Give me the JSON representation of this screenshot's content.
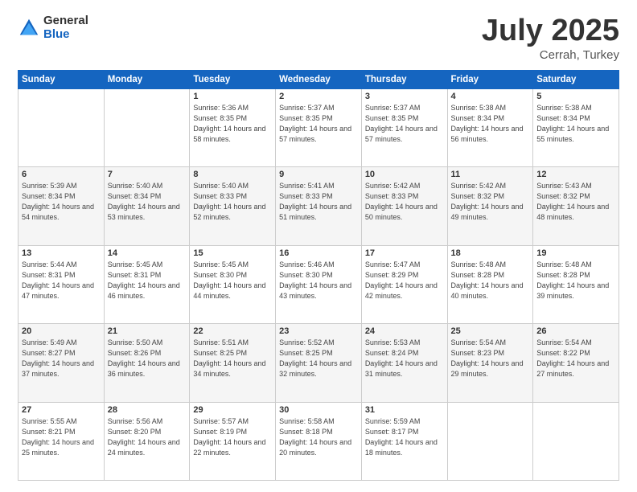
{
  "header": {
    "logo_general": "General",
    "logo_blue": "Blue",
    "title": "July 2025",
    "location": "Cerrah, Turkey"
  },
  "weekdays": [
    "Sunday",
    "Monday",
    "Tuesday",
    "Wednesday",
    "Thursday",
    "Friday",
    "Saturday"
  ],
  "weeks": [
    [
      {
        "day": "",
        "sunrise": "",
        "sunset": "",
        "daylight": ""
      },
      {
        "day": "",
        "sunrise": "",
        "sunset": "",
        "daylight": ""
      },
      {
        "day": "1",
        "sunrise": "Sunrise: 5:36 AM",
        "sunset": "Sunset: 8:35 PM",
        "daylight": "Daylight: 14 hours and 58 minutes."
      },
      {
        "day": "2",
        "sunrise": "Sunrise: 5:37 AM",
        "sunset": "Sunset: 8:35 PM",
        "daylight": "Daylight: 14 hours and 57 minutes."
      },
      {
        "day": "3",
        "sunrise": "Sunrise: 5:37 AM",
        "sunset": "Sunset: 8:35 PM",
        "daylight": "Daylight: 14 hours and 57 minutes."
      },
      {
        "day": "4",
        "sunrise": "Sunrise: 5:38 AM",
        "sunset": "Sunset: 8:34 PM",
        "daylight": "Daylight: 14 hours and 56 minutes."
      },
      {
        "day": "5",
        "sunrise": "Sunrise: 5:38 AM",
        "sunset": "Sunset: 8:34 PM",
        "daylight": "Daylight: 14 hours and 55 minutes."
      }
    ],
    [
      {
        "day": "6",
        "sunrise": "Sunrise: 5:39 AM",
        "sunset": "Sunset: 8:34 PM",
        "daylight": "Daylight: 14 hours and 54 minutes."
      },
      {
        "day": "7",
        "sunrise": "Sunrise: 5:40 AM",
        "sunset": "Sunset: 8:34 PM",
        "daylight": "Daylight: 14 hours and 53 minutes."
      },
      {
        "day": "8",
        "sunrise": "Sunrise: 5:40 AM",
        "sunset": "Sunset: 8:33 PM",
        "daylight": "Daylight: 14 hours and 52 minutes."
      },
      {
        "day": "9",
        "sunrise": "Sunrise: 5:41 AM",
        "sunset": "Sunset: 8:33 PM",
        "daylight": "Daylight: 14 hours and 51 minutes."
      },
      {
        "day": "10",
        "sunrise": "Sunrise: 5:42 AM",
        "sunset": "Sunset: 8:33 PM",
        "daylight": "Daylight: 14 hours and 50 minutes."
      },
      {
        "day": "11",
        "sunrise": "Sunrise: 5:42 AM",
        "sunset": "Sunset: 8:32 PM",
        "daylight": "Daylight: 14 hours and 49 minutes."
      },
      {
        "day": "12",
        "sunrise": "Sunrise: 5:43 AM",
        "sunset": "Sunset: 8:32 PM",
        "daylight": "Daylight: 14 hours and 48 minutes."
      }
    ],
    [
      {
        "day": "13",
        "sunrise": "Sunrise: 5:44 AM",
        "sunset": "Sunset: 8:31 PM",
        "daylight": "Daylight: 14 hours and 47 minutes."
      },
      {
        "day": "14",
        "sunrise": "Sunrise: 5:45 AM",
        "sunset": "Sunset: 8:31 PM",
        "daylight": "Daylight: 14 hours and 46 minutes."
      },
      {
        "day": "15",
        "sunrise": "Sunrise: 5:45 AM",
        "sunset": "Sunset: 8:30 PM",
        "daylight": "Daylight: 14 hours and 44 minutes."
      },
      {
        "day": "16",
        "sunrise": "Sunrise: 5:46 AM",
        "sunset": "Sunset: 8:30 PM",
        "daylight": "Daylight: 14 hours and 43 minutes."
      },
      {
        "day": "17",
        "sunrise": "Sunrise: 5:47 AM",
        "sunset": "Sunset: 8:29 PM",
        "daylight": "Daylight: 14 hours and 42 minutes."
      },
      {
        "day": "18",
        "sunrise": "Sunrise: 5:48 AM",
        "sunset": "Sunset: 8:28 PM",
        "daylight": "Daylight: 14 hours and 40 minutes."
      },
      {
        "day": "19",
        "sunrise": "Sunrise: 5:48 AM",
        "sunset": "Sunset: 8:28 PM",
        "daylight": "Daylight: 14 hours and 39 minutes."
      }
    ],
    [
      {
        "day": "20",
        "sunrise": "Sunrise: 5:49 AM",
        "sunset": "Sunset: 8:27 PM",
        "daylight": "Daylight: 14 hours and 37 minutes."
      },
      {
        "day": "21",
        "sunrise": "Sunrise: 5:50 AM",
        "sunset": "Sunset: 8:26 PM",
        "daylight": "Daylight: 14 hours and 36 minutes."
      },
      {
        "day": "22",
        "sunrise": "Sunrise: 5:51 AM",
        "sunset": "Sunset: 8:25 PM",
        "daylight": "Daylight: 14 hours and 34 minutes."
      },
      {
        "day": "23",
        "sunrise": "Sunrise: 5:52 AM",
        "sunset": "Sunset: 8:25 PM",
        "daylight": "Daylight: 14 hours and 32 minutes."
      },
      {
        "day": "24",
        "sunrise": "Sunrise: 5:53 AM",
        "sunset": "Sunset: 8:24 PM",
        "daylight": "Daylight: 14 hours and 31 minutes."
      },
      {
        "day": "25",
        "sunrise": "Sunrise: 5:54 AM",
        "sunset": "Sunset: 8:23 PM",
        "daylight": "Daylight: 14 hours and 29 minutes."
      },
      {
        "day": "26",
        "sunrise": "Sunrise: 5:54 AM",
        "sunset": "Sunset: 8:22 PM",
        "daylight": "Daylight: 14 hours and 27 minutes."
      }
    ],
    [
      {
        "day": "27",
        "sunrise": "Sunrise: 5:55 AM",
        "sunset": "Sunset: 8:21 PM",
        "daylight": "Daylight: 14 hours and 25 minutes."
      },
      {
        "day": "28",
        "sunrise": "Sunrise: 5:56 AM",
        "sunset": "Sunset: 8:20 PM",
        "daylight": "Daylight: 14 hours and 24 minutes."
      },
      {
        "day": "29",
        "sunrise": "Sunrise: 5:57 AM",
        "sunset": "Sunset: 8:19 PM",
        "daylight": "Daylight: 14 hours and 22 minutes."
      },
      {
        "day": "30",
        "sunrise": "Sunrise: 5:58 AM",
        "sunset": "Sunset: 8:18 PM",
        "daylight": "Daylight: 14 hours and 20 minutes."
      },
      {
        "day": "31",
        "sunrise": "Sunrise: 5:59 AM",
        "sunset": "Sunset: 8:17 PM",
        "daylight": "Daylight: 14 hours and 18 minutes."
      },
      {
        "day": "",
        "sunrise": "",
        "sunset": "",
        "daylight": ""
      },
      {
        "day": "",
        "sunrise": "",
        "sunset": "",
        "daylight": ""
      }
    ]
  ]
}
